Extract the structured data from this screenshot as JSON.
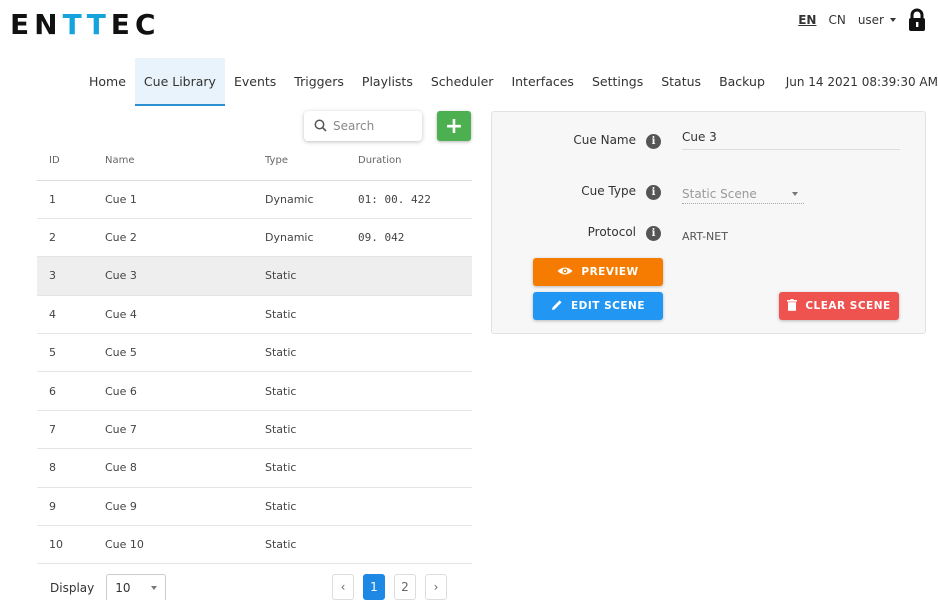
{
  "brand": {
    "letters": [
      "E",
      "N",
      "T",
      "T",
      "E",
      "C"
    ]
  },
  "header": {
    "lang_en": "EN",
    "lang_cn": "CN",
    "user_label": "user",
    "datetime": "Jun 14 2021 08:39:30 AM"
  },
  "nav": {
    "items": [
      {
        "label": "Home"
      },
      {
        "label": "Cue Library"
      },
      {
        "label": "Events"
      },
      {
        "label": "Triggers"
      },
      {
        "label": "Playlists"
      },
      {
        "label": "Scheduler"
      },
      {
        "label": "Interfaces"
      },
      {
        "label": "Settings"
      },
      {
        "label": "Status"
      },
      {
        "label": "Backup"
      }
    ],
    "active": "Cue Library"
  },
  "search": {
    "placeholder": "Search",
    "value": ""
  },
  "add_button": {
    "label": "+"
  },
  "table": {
    "headers": [
      "ID",
      "Name",
      "Type",
      "Duration"
    ],
    "rows": [
      {
        "id": "1",
        "name": "Cue 1",
        "type": "Dynamic",
        "duration": "01: 00. 422"
      },
      {
        "id": "2",
        "name": "Cue 2",
        "type": "Dynamic",
        "duration": "09. 042"
      },
      {
        "id": "3",
        "name": "Cue 3",
        "type": "Static",
        "duration": ""
      },
      {
        "id": "4",
        "name": "Cue 4",
        "type": "Static",
        "duration": ""
      },
      {
        "id": "5",
        "name": "Cue 5",
        "type": "Static",
        "duration": ""
      },
      {
        "id": "6",
        "name": "Cue 6",
        "type": "Static",
        "duration": ""
      },
      {
        "id": "7",
        "name": "Cue 7",
        "type": "Static",
        "duration": ""
      },
      {
        "id": "8",
        "name": "Cue 8",
        "type": "Static",
        "duration": ""
      },
      {
        "id": "9",
        "name": "Cue 9",
        "type": "Static",
        "duration": ""
      },
      {
        "id": "10",
        "name": "Cue 10",
        "type": "Static",
        "duration": ""
      }
    ],
    "selected_index": 2
  },
  "footer": {
    "display_label": "Display",
    "display_value": "10",
    "pages": [
      "1",
      "2"
    ],
    "current_page": "1",
    "prev": "‹",
    "next": "›"
  },
  "panel": {
    "cue_name_label": "Cue Name",
    "cue_name_value": "Cue 3",
    "cue_type_label": "Cue Type",
    "cue_type_value": "Static Scene",
    "protocol_label": "Protocol",
    "protocol_value": "ART-NET",
    "info_glyph": "i",
    "preview_label": "PREVIEW",
    "edit_label": "EDIT SCENE",
    "clear_label": "CLEAR SCENE"
  },
  "colors": {
    "accent": "#2196f3",
    "preview": "#f57c00",
    "clear": "#ef5350",
    "add": "#4caf50",
    "brand_t": "#15a3dc"
  }
}
